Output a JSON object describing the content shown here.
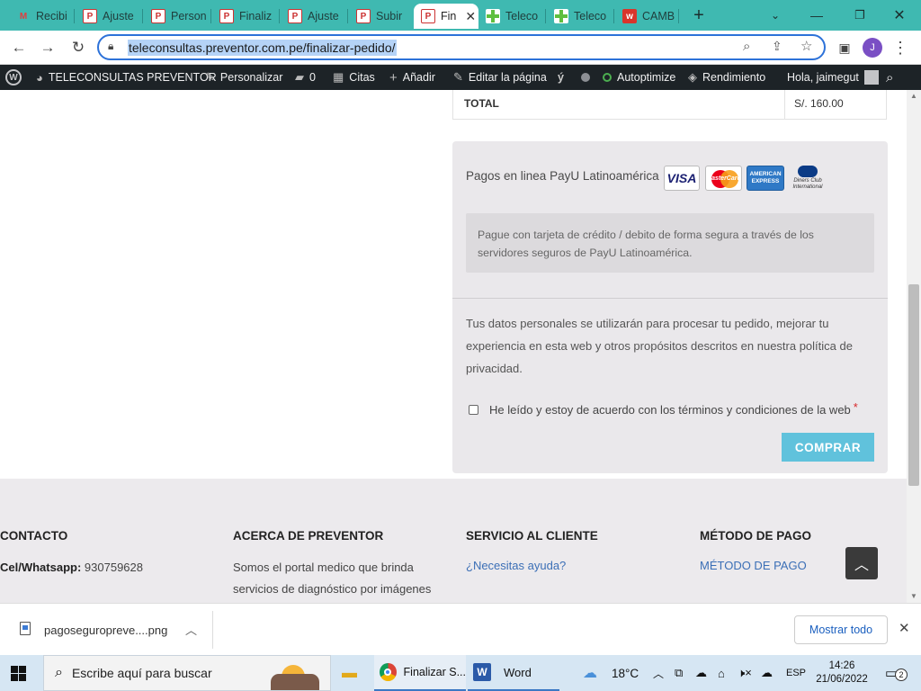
{
  "browser": {
    "tabs": [
      {
        "label": "Recibi",
        "icon": "gmail-icon"
      },
      {
        "label": "Ajuste",
        "icon": "preventor-icon"
      },
      {
        "label": "Person",
        "icon": "preventor-icon"
      },
      {
        "label": "Finaliz",
        "icon": "preventor-icon"
      },
      {
        "label": "Ajuste",
        "icon": "preventor-icon"
      },
      {
        "label": "Subir",
        "icon": "preventor-icon"
      },
      {
        "label": "Fin",
        "icon": "preventor-icon",
        "active": true
      },
      {
        "label": "Teleco",
        "icon": "cross-icon"
      },
      {
        "label": "Teleco",
        "icon": "cross-icon"
      },
      {
        "label": "CAMB",
        "icon": "w-icon"
      }
    ],
    "url": "teleconsultas.preventor.com.pe/finalizar-pedido/",
    "profile_initial": "J"
  },
  "adminbar": {
    "site": "TELECONSULTAS PREVENTOR",
    "customize": "Personalizar",
    "comments_count": "0",
    "appointments": "Citas",
    "add_new": "Añadir",
    "edit_page": "Editar la página",
    "autoptimize": "Autoptimize",
    "performance": "Rendimiento",
    "greeting": "Hola, jaimegut"
  },
  "order": {
    "total_label": "TOTAL",
    "total_value": "S/. 160.00"
  },
  "payment": {
    "method_title": "Pagos en linea PayU Latinoamérica",
    "cards": [
      "VISA",
      "MasterCard",
      "AMERICAN EXPRESS",
      "Diners Club International"
    ],
    "description": "Pague con tarjeta de crédito / debito de forma segura a través de los servidores seguros de PayU Latinoamérica.",
    "privacy_text": "Tus datos personales se utilizarán para procesar tu pedido, mejorar tu experiencia en esta web y otros propósitos descritos en nuestra política de privacidad.",
    "terms_label": "He leído y estoy de acuerdo con los términos y condiciones de la web",
    "required_mark": "*",
    "buy_button": "COMPRAR"
  },
  "footer": {
    "contact_heading": "CONTACTO",
    "phone_label": "Cel/Whatsapp:",
    "phone_value": "930759628",
    "about_heading": "ACERCA DE PREVENTOR",
    "about_text_1": "Somos el portal medico que brinda",
    "about_text_2": "servicios de diagnóstico por imágenes",
    "service_heading": "SERVICIO AL CLIENTE",
    "service_link": "¿Necesitas ayuda?",
    "payment_heading": "MÉTODO DE PAGO",
    "payment_link": "MÉTODO DE PAGO"
  },
  "downloads": {
    "file_name": "pagoseguropreve....png",
    "show_all": "Mostrar todo"
  },
  "taskbar": {
    "search_placeholder": "Escribe aquí para buscar",
    "chrome_label": "Finalizar S...",
    "word_label": "Word",
    "temperature": "18°C",
    "language": "ESP",
    "time": "14:26",
    "date": "21/06/2022",
    "notifications": "2"
  }
}
